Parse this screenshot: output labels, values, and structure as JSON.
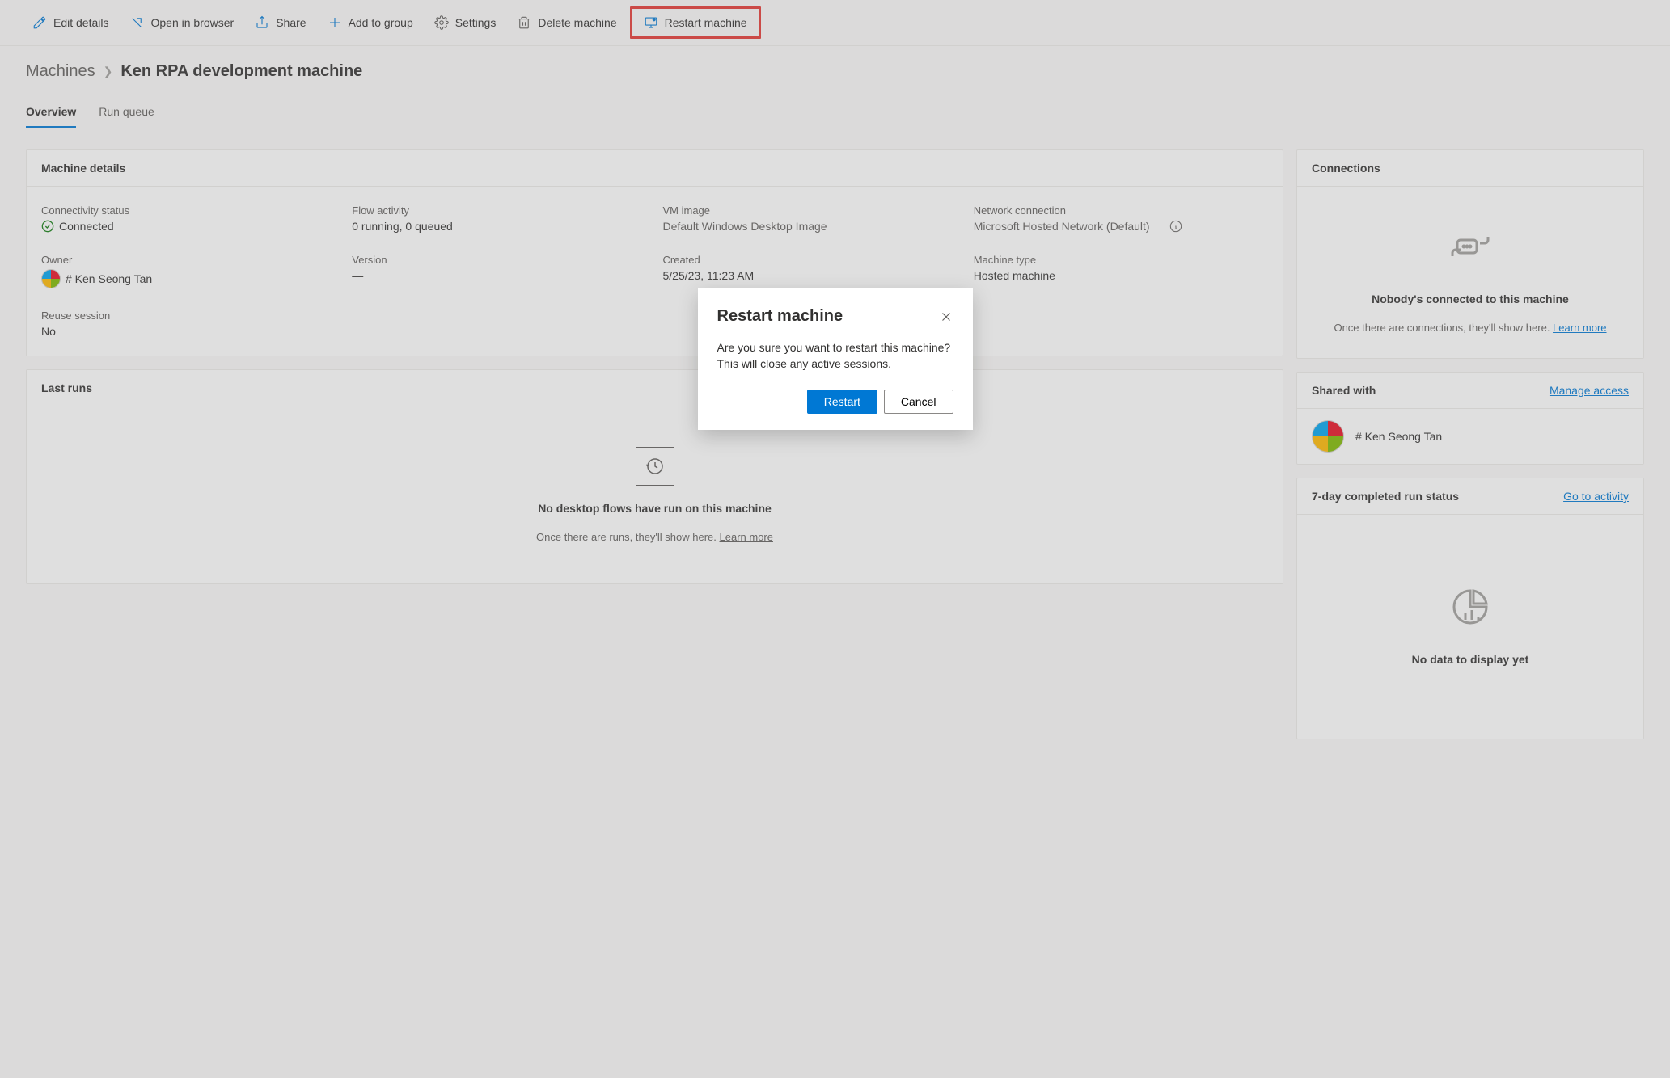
{
  "toolbar": {
    "edit": "Edit details",
    "open": "Open in browser",
    "share": "Share",
    "add": "Add to group",
    "settings": "Settings",
    "delete": "Delete machine",
    "restart": "Restart machine"
  },
  "breadcrumb": {
    "root": "Machines",
    "current": "Ken RPA development machine"
  },
  "tabs": {
    "overview": "Overview",
    "runqueue": "Run queue"
  },
  "details": {
    "title": "Machine details",
    "connectivity_label": "Connectivity status",
    "connectivity_value": "Connected",
    "flow_label": "Flow activity",
    "flow_value": "0 running, 0 queued",
    "vm_label": "VM image",
    "vm_value": "Default Windows Desktop Image",
    "network_label": "Network connection",
    "network_value": "Microsoft Hosted Network (Default)",
    "owner_label": "Owner",
    "owner_value": "# Ken Seong Tan",
    "version_label": "Version",
    "version_value": "—",
    "created_label": "Created",
    "created_value": "5/25/23, 11:23 AM",
    "type_label": "Machine type",
    "type_value": "Hosted machine",
    "reuse_label": "Reuse session",
    "reuse_value": "No"
  },
  "lastruns": {
    "title": "Last runs",
    "empty_title": "No desktop flows have run on this machine",
    "empty_sub": "Once there are runs, they'll show here. ",
    "learn_more": "Learn more"
  },
  "connections": {
    "title": "Connections",
    "empty_title": "Nobody's connected to this machine",
    "empty_sub": "Once there are connections, they'll show here. ",
    "learn_more": "Learn more"
  },
  "shared": {
    "title": "Shared with",
    "manage": "Manage access",
    "user": "# Ken Seong Tan"
  },
  "runstatus": {
    "title": "7-day completed run status",
    "link": "Go to activity",
    "empty": "No data to display yet"
  },
  "dialog": {
    "title": "Restart machine",
    "body": "Are you sure you want to restart this machine? This will close any active sessions.",
    "primary": "Restart",
    "secondary": "Cancel"
  }
}
